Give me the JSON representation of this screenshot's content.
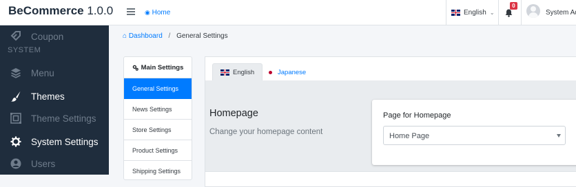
{
  "app": {
    "brand_name": "BeCommerce",
    "version": "1.0.0"
  },
  "topbar": {
    "home_label": "Home",
    "language_label": "English",
    "notification_count": "0",
    "user_name": "System Ad"
  },
  "sidebar": {
    "items": [
      {
        "label": "Coupon",
        "icon": "tag-icon",
        "state": "dim"
      },
      {
        "label": "Menu",
        "icon": "layers-icon",
        "state": "dim"
      },
      {
        "label": "Themes",
        "icon": "brush-icon",
        "state": "bright"
      },
      {
        "label": "Theme Settings",
        "icon": "theme-settings-icon",
        "state": "dim"
      },
      {
        "label": "System Settings",
        "icon": "gear-icon",
        "state": "bright"
      },
      {
        "label": "Users",
        "icon": "users-icon",
        "state": "dim"
      }
    ],
    "section_header": "SYSTEM"
  },
  "breadcrumb": {
    "root": "Dashboard",
    "current": "General Settings"
  },
  "settings_nav": {
    "header": "Main Settings",
    "items": [
      {
        "label": "General Settings",
        "active": true
      },
      {
        "label": "News Settings",
        "active": false
      },
      {
        "label": "Store Settings",
        "active": false
      },
      {
        "label": "Product Settings",
        "active": false
      },
      {
        "label": "Shipping Settings",
        "active": false
      }
    ]
  },
  "tabs": [
    {
      "label": "English",
      "active": true
    },
    {
      "label": "Japanese",
      "active": false
    }
  ],
  "section": {
    "title": "Homepage",
    "description": "Change your homepage content"
  },
  "field": {
    "label": "Page for Homepage",
    "value": "Home Page"
  },
  "colors": {
    "sidebar_bg": "#1f2d3d",
    "accent": "#007bff",
    "badge": "#dc3545"
  }
}
